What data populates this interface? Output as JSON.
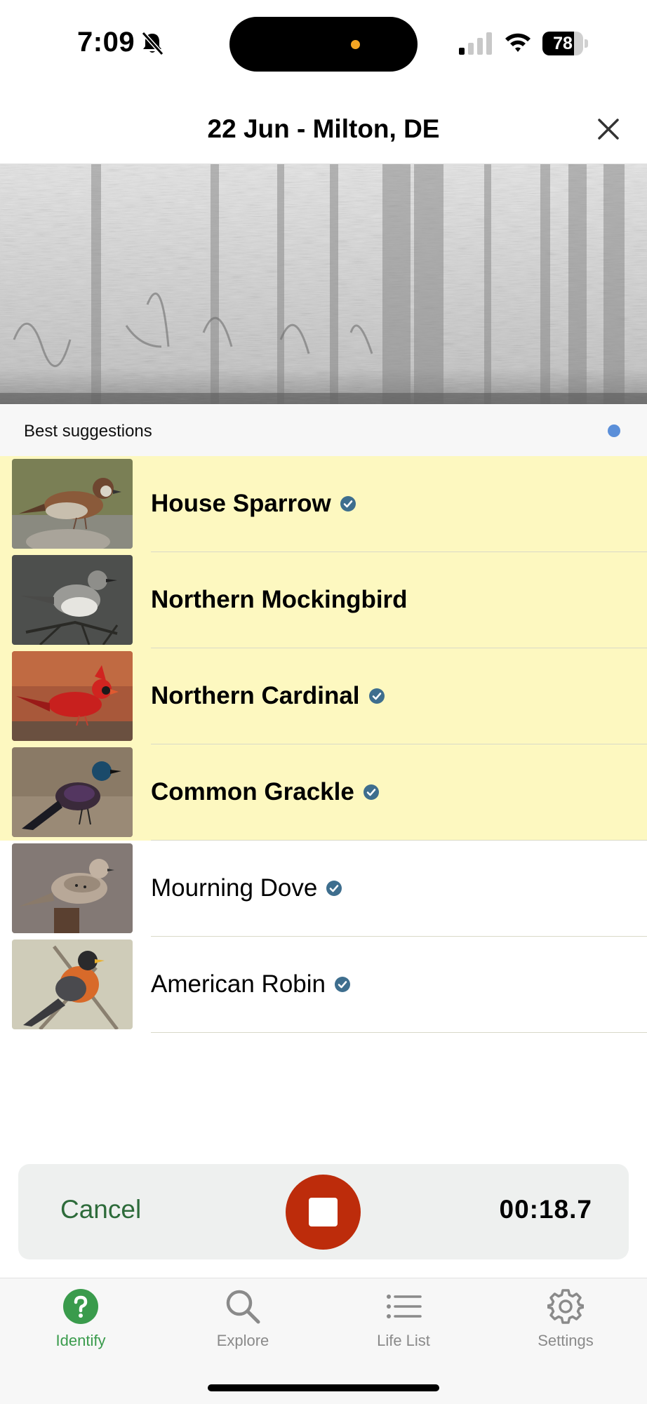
{
  "status_bar": {
    "time": "7:09",
    "silent_icon": "bell-slash-icon",
    "signal_icon": "cellular-signal-icon",
    "wifi_icon": "wifi-icon",
    "battery_percent": "78",
    "battery_level": 0.78
  },
  "header": {
    "title": "22 Jun - Milton, DE",
    "close_icon": "close-icon"
  },
  "spectrogram": {
    "icon": "spectrogram"
  },
  "suggestions": {
    "label": "Best suggestions",
    "live_indicator_color": "#5b8fd9",
    "highlight_color": "#fdf8c0",
    "items": [
      {
        "name": "House Sparrow",
        "verified": true,
        "highlighted": true
      },
      {
        "name": "Northern Mockingbird",
        "verified": false,
        "highlighted": true
      },
      {
        "name": "Northern Cardinal",
        "verified": true,
        "highlighted": true
      },
      {
        "name": "Common Grackle",
        "verified": true,
        "highlighted": true
      },
      {
        "name": "Mourning Dove",
        "verified": true,
        "highlighted": false
      },
      {
        "name": "American Robin",
        "verified": true,
        "highlighted": false
      }
    ]
  },
  "recorder": {
    "cancel_label": "Cancel",
    "stop_icon": "stop-icon",
    "elapsed": "00:18.7",
    "stop_color": "#bd2c0b"
  },
  "tabbar": {
    "tabs": [
      {
        "label": "Identify",
        "icon": "question-circle-icon",
        "active": true
      },
      {
        "label": "Explore",
        "icon": "search-icon",
        "active": false
      },
      {
        "label": "Life List",
        "icon": "list-icon",
        "active": false
      },
      {
        "label": "Settings",
        "icon": "gear-icon",
        "active": false
      }
    ],
    "active_color": "#3a9b4c"
  }
}
